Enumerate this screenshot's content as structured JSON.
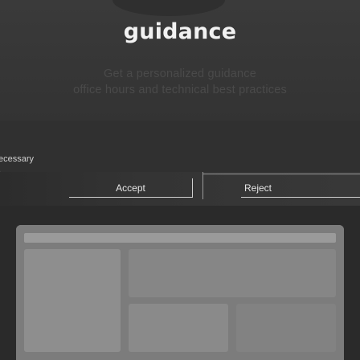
{
  "hero": {
    "headline": "guidance",
    "subcopy_line1": "Get a personalized guidance",
    "subcopy_line2": "office hours and technical best practices"
  },
  "consent": {
    "text_lines": [
      "ecessary",
      ","
    ],
    "accept_label": "Accept",
    "reject_label": "Reject"
  }
}
